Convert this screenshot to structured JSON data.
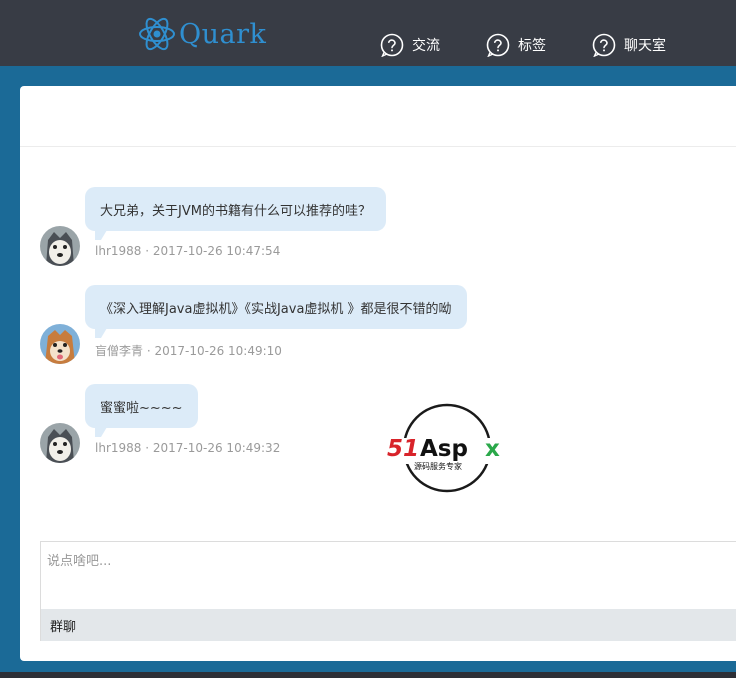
{
  "header": {
    "logo_text": "Quark",
    "nav": [
      {
        "label": "交流",
        "icon": "help-circle-icon"
      },
      {
        "label": "标签",
        "icon": "help-circle-icon"
      },
      {
        "label": "聊天室",
        "icon": "help-circle-icon"
      }
    ]
  },
  "messages": [
    {
      "text": "大兄弟，关于JVM的书籍有什么可以推荐的哇？",
      "author": "lhr1988",
      "time": "2017-10-26 10:47:54",
      "avatar": "husky-avatar"
    },
    {
      "text": "《深入理解Java虚拟机》《实战Java虚拟机 》都是很不错的呦",
      "author": "盲僧李青",
      "time": "2017-10-26 10:49:10",
      "avatar": "shiba-avatar"
    },
    {
      "text": "蜜蜜啦~~~~",
      "author": "lhr1988",
      "time": "2017-10-26 10:49:32",
      "avatar": "husky-avatar"
    }
  ],
  "watermark": {
    "brand": "51Aspx",
    "subtitle": "源码服务专家"
  },
  "composer": {
    "placeholder": "说点啥吧...",
    "mode_label": "群聊"
  },
  "colors": {
    "topbar": "#383c45",
    "background": "#1b6a97",
    "bubble": "#dcebf8",
    "logo": "#2f8fd0"
  }
}
